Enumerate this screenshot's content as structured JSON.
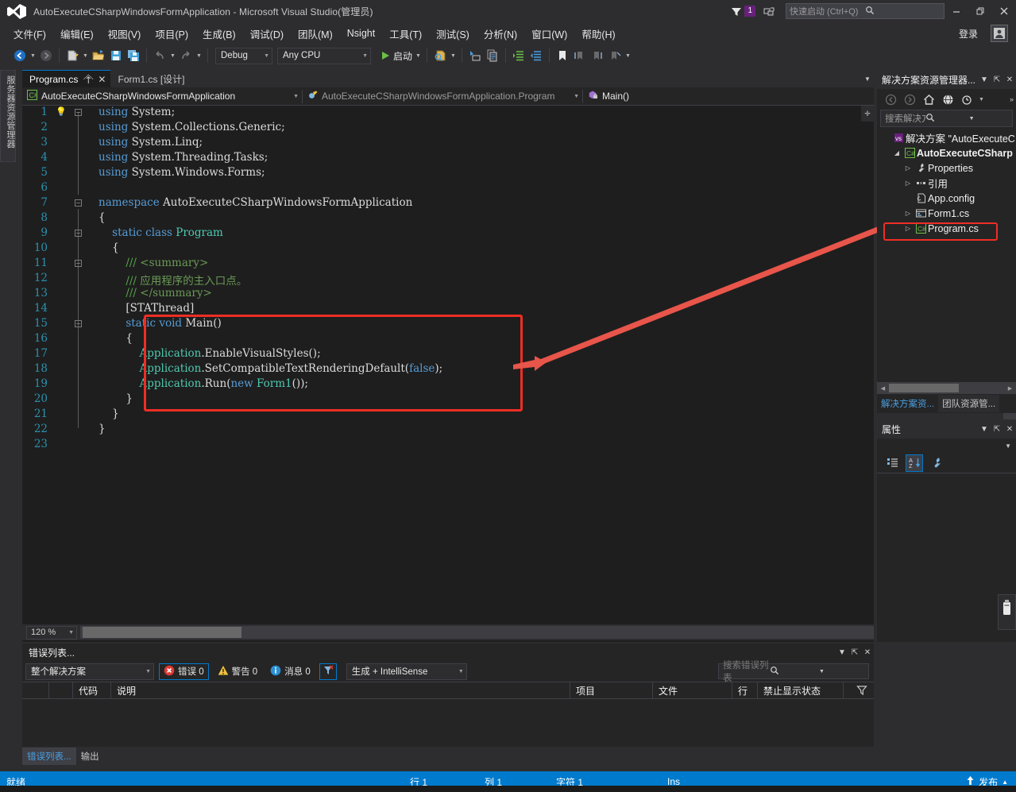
{
  "window": {
    "title": "AutoExecuteCSharpWindowsFormApplication - Microsoft Visual Studio(管理员)",
    "logo_icon": "visual-studio-logo",
    "feedback_icon": "feedback-icon",
    "feedback_badge": "1",
    "screen_icon": "screen-share-icon",
    "minimize_icon": "minimize-icon",
    "restore_icon": "restore-icon",
    "close_icon": "close-icon",
    "signin_label": "登录",
    "account_icon": "account-icon"
  },
  "quick_launch": {
    "placeholder": "快速启动 (Ctrl+Q)",
    "search_icon": "search-icon"
  },
  "menu": {
    "items": [
      {
        "label": "文件(F)"
      },
      {
        "label": "编辑(E)"
      },
      {
        "label": "视图(V)"
      },
      {
        "label": "项目(P)"
      },
      {
        "label": "生成(B)"
      },
      {
        "label": "调试(D)"
      },
      {
        "label": "团队(M)"
      },
      {
        "label": "Nsight"
      },
      {
        "label": "工具(T)"
      },
      {
        "label": "测试(S)"
      },
      {
        "label": "分析(N)"
      },
      {
        "label": "窗口(W)"
      },
      {
        "label": "帮助(H)"
      }
    ]
  },
  "toolbar": {
    "back_icon": "navigate-back-icon",
    "forward_icon": "navigate-forward-icon",
    "new_project_icon": "new-project-icon",
    "open_file_icon": "open-file-icon",
    "save_icon": "save-icon",
    "save_all_icon": "save-all-icon",
    "undo_icon": "undo-icon",
    "redo_icon": "redo-icon",
    "config_value": "Debug",
    "platform_value": "Any CPU",
    "start_label": "启动",
    "start_icon": "play-icon",
    "find_icon": "find-in-files-icon",
    "step_icon": "step-into-icon",
    "copy_icon": "copy-icon",
    "indent_icon": "increase-indent-icon",
    "outdent_icon": "decrease-indent-icon",
    "bookmark_icon": "bookmark-icon",
    "bm_prev_icon": "previous-bookmark-icon",
    "bm_next_icon": "next-bookmark-icon",
    "bm_clear_icon": "clear-bookmarks-icon"
  },
  "left_dock": {
    "toolbox_label": "服务器资源管理器"
  },
  "editor": {
    "tabs": [
      {
        "label": "Program.cs",
        "active": true,
        "pin_icon": "pin-icon",
        "close_icon": "close-icon"
      },
      {
        "label": "Form1.cs [设计]",
        "active": false
      }
    ],
    "nav": {
      "project_icon": "csharp-file-icon",
      "project": "AutoExecuteCSharpWindowsFormApplication",
      "type_icon": "class-icon",
      "type": "AutoExecuteCSharpWindowsFormApplication.Program",
      "member_icon": "method-private-icon",
      "member": "Main()"
    },
    "zoom_level": "120 %",
    "bulb_icon": "lightbulb-icon",
    "lines": [
      {
        "n": "1",
        "indent": 0,
        "fold": "minus",
        "bulb": true,
        "spans": [
          {
            "t": "using ",
            "c": "kw"
          },
          {
            "t": "System;",
            "c": "pln"
          }
        ]
      },
      {
        "n": "2",
        "indent": 0,
        "spans": [
          {
            "t": "using ",
            "c": "kw"
          },
          {
            "t": "System.Collections.Generic;",
            "c": "pln"
          }
        ]
      },
      {
        "n": "3",
        "indent": 0,
        "spans": [
          {
            "t": "using ",
            "c": "kw"
          },
          {
            "t": "System.Linq;",
            "c": "pln"
          }
        ]
      },
      {
        "n": "4",
        "indent": 0,
        "spans": [
          {
            "t": "using ",
            "c": "kw"
          },
          {
            "t": "System.Threading.Tasks;",
            "c": "pln"
          }
        ]
      },
      {
        "n": "5",
        "indent": 0,
        "spans": [
          {
            "t": "using ",
            "c": "kw"
          },
          {
            "t": "System.Windows.Forms;",
            "c": "pln"
          }
        ]
      },
      {
        "n": "6",
        "indent": 0,
        "spans": []
      },
      {
        "n": "7",
        "indent": 0,
        "fold": "minus",
        "spans": [
          {
            "t": "namespace ",
            "c": "kw"
          },
          {
            "t": "AutoExecuteCSharpWindowsFormApplication",
            "c": "pln"
          }
        ]
      },
      {
        "n": "8",
        "indent": 0,
        "spans": [
          {
            "t": "{",
            "c": "pln"
          }
        ]
      },
      {
        "n": "9",
        "indent": 1,
        "fold": "minus",
        "spans": [
          {
            "t": "    static class ",
            "c": "kw"
          },
          {
            "t": "Program",
            "c": "typ"
          }
        ]
      },
      {
        "n": "10",
        "indent": 1,
        "spans": [
          {
            "t": "    {",
            "c": "pln"
          }
        ]
      },
      {
        "n": "11",
        "indent": 2,
        "fold": "minus",
        "spans": [
          {
            "t": "        /// ",
            "c": "cmt"
          },
          {
            "t": "<summary>",
            "c": "cmtx"
          }
        ]
      },
      {
        "n": "12",
        "indent": 2,
        "spans": [
          {
            "t": "        /// ",
            "c": "cmt"
          },
          {
            "t": "应用程序的主入口点。",
            "c": "cmtx"
          }
        ]
      },
      {
        "n": "13",
        "indent": 2,
        "spans": [
          {
            "t": "        /// ",
            "c": "cmt"
          },
          {
            "t": "</summary>",
            "c": "cmtx"
          }
        ]
      },
      {
        "n": "14",
        "indent": 2,
        "spans": [
          {
            "t": "        [STAThread]",
            "c": "pln"
          }
        ]
      },
      {
        "n": "15",
        "indent": 2,
        "fold": "minus",
        "spans": [
          {
            "t": "        static void ",
            "c": "kw"
          },
          {
            "t": "Main",
            "c": "pln"
          },
          {
            "t": "()",
            "c": "pln"
          }
        ]
      },
      {
        "n": "16",
        "indent": 2,
        "spans": [
          {
            "t": "        {",
            "c": "pln"
          }
        ]
      },
      {
        "n": "17",
        "indent": 3,
        "spans": [
          {
            "t": "            ",
            "c": "pln"
          },
          {
            "t": "Application",
            "c": "kw2"
          },
          {
            "t": ".EnableVisualStyles();",
            "c": "pln"
          }
        ]
      },
      {
        "n": "18",
        "indent": 3,
        "spans": [
          {
            "t": "            ",
            "c": "pln"
          },
          {
            "t": "Application",
            "c": "kw2"
          },
          {
            "t": ".SetCompatibleTextRenderingDefault(",
            "c": "pln"
          },
          {
            "t": "false",
            "c": "kw"
          },
          {
            "t": ");",
            "c": "pln"
          }
        ]
      },
      {
        "n": "19",
        "indent": 3,
        "spans": [
          {
            "t": "            ",
            "c": "pln"
          },
          {
            "t": "Application",
            "c": "kw2"
          },
          {
            "t": ".Run(",
            "c": "pln"
          },
          {
            "t": "new ",
            "c": "kw"
          },
          {
            "t": "Form1",
            "c": "typ"
          },
          {
            "t": "());",
            "c": "pln"
          }
        ]
      },
      {
        "n": "20",
        "indent": 2,
        "spans": [
          {
            "t": "        }",
            "c": "pln"
          }
        ]
      },
      {
        "n": "21",
        "indent": 1,
        "spans": [
          {
            "t": "    }",
            "c": "pln"
          }
        ]
      },
      {
        "n": "22",
        "indent": 0,
        "spans": [
          {
            "t": "}",
            "c": "pln"
          }
        ]
      },
      {
        "n": "23",
        "indent": 0,
        "spans": []
      }
    ]
  },
  "annotation": {
    "highlight_color": "#ee2e24",
    "arrow_color": "#e8554a",
    "code_box_label": "main-method-highlight",
    "tree_box_label": "program-cs-highlight"
  },
  "solution_explorer": {
    "title": "解决方案资源管理器...",
    "dropdown_icon": "chevron-down-icon",
    "pin_icon": "pin-icon",
    "close_icon": "close-icon",
    "toolbar": {
      "back_icon": "back-icon",
      "forward_icon": "forward-icon",
      "home_icon": "home-icon",
      "sync_icon": "sync-views-icon",
      "pending_icon": "pending-changes-icon",
      "overflow_icon": "overflow-icon"
    },
    "search_placeholder": "搜索解决方案资源管理器",
    "search_icon": "search-icon",
    "tree": [
      {
        "label": "解决方案 \"AutoExecuteC",
        "icon": "solution-icon",
        "twist": "",
        "depth": 0,
        "bold": false
      },
      {
        "label": "AutoExecuteCSharp",
        "icon": "csharp-project-icon",
        "twist": "expanded",
        "depth": 1,
        "bold": true
      },
      {
        "label": "Properties",
        "icon": "properties-wrench-icon",
        "twist": "collapsed",
        "depth": 2,
        "bold": false
      },
      {
        "label": "引用",
        "icon": "references-icon",
        "twist": "collapsed",
        "depth": 2,
        "bold": false
      },
      {
        "label": "App.config",
        "icon": "config-file-icon",
        "twist": "",
        "depth": 2,
        "bold": false
      },
      {
        "label": "Form1.cs",
        "icon": "form-file-icon",
        "twist": "collapsed",
        "depth": 2,
        "bold": false
      },
      {
        "label": "Program.cs",
        "icon": "csharp-file-icon",
        "twist": "collapsed",
        "depth": 2,
        "bold": false,
        "highlighted": true
      }
    ],
    "tabs": [
      {
        "label": "解决方案资...",
        "active": true
      },
      {
        "label": "团队资源管...",
        "active": false
      }
    ]
  },
  "properties": {
    "title": "属性",
    "dropdown_icon": "chevron-down-icon",
    "pin_icon": "pin-icon",
    "close_icon": "close-icon",
    "categorized_icon": "categorized-view-icon",
    "alphabetical_icon": "alphabetical-sort-icon",
    "properties_icon": "properties-wrench-icon"
  },
  "usb_tab": {
    "icon": "usb-device-icon"
  },
  "error_list": {
    "title": "错误列表...",
    "dropdown_icon": "chevron-down-icon",
    "pin_icon": "pin-icon",
    "close_icon": "close-icon",
    "scope_value": "整个解决方案",
    "errors_label": "错误 0",
    "errors_icon": "error-icon",
    "warnings_label": "警告 0",
    "warnings_icon": "warning-icon",
    "messages_label": "消息 0",
    "messages_icon": "info-icon",
    "filter_icon": "clear-filter-icon",
    "build_filter_value": "生成 + IntelliSense",
    "search_placeholder": "搜索错误列表",
    "search_icon": "search-icon",
    "columns": [
      "",
      "",
      "代码",
      "说明",
      "项目",
      "文件",
      "行",
      "禁止显示状态"
    ],
    "column_filter_icon": "filter-icon",
    "rows": [],
    "tabs": [
      {
        "label": "错误列表...",
        "active": true
      },
      {
        "label": "输出",
        "active": false
      }
    ]
  },
  "status_bar": {
    "state": "就绪",
    "line_label": "行 1",
    "col_label": "列 1",
    "char_label": "字符 1",
    "insert_mode": "Ins",
    "publish_label": "发布",
    "publish_icon": "upload-arrow-icon",
    "publish_caret_icon": "caret-up-icon",
    "accent_color": "#007acc"
  }
}
